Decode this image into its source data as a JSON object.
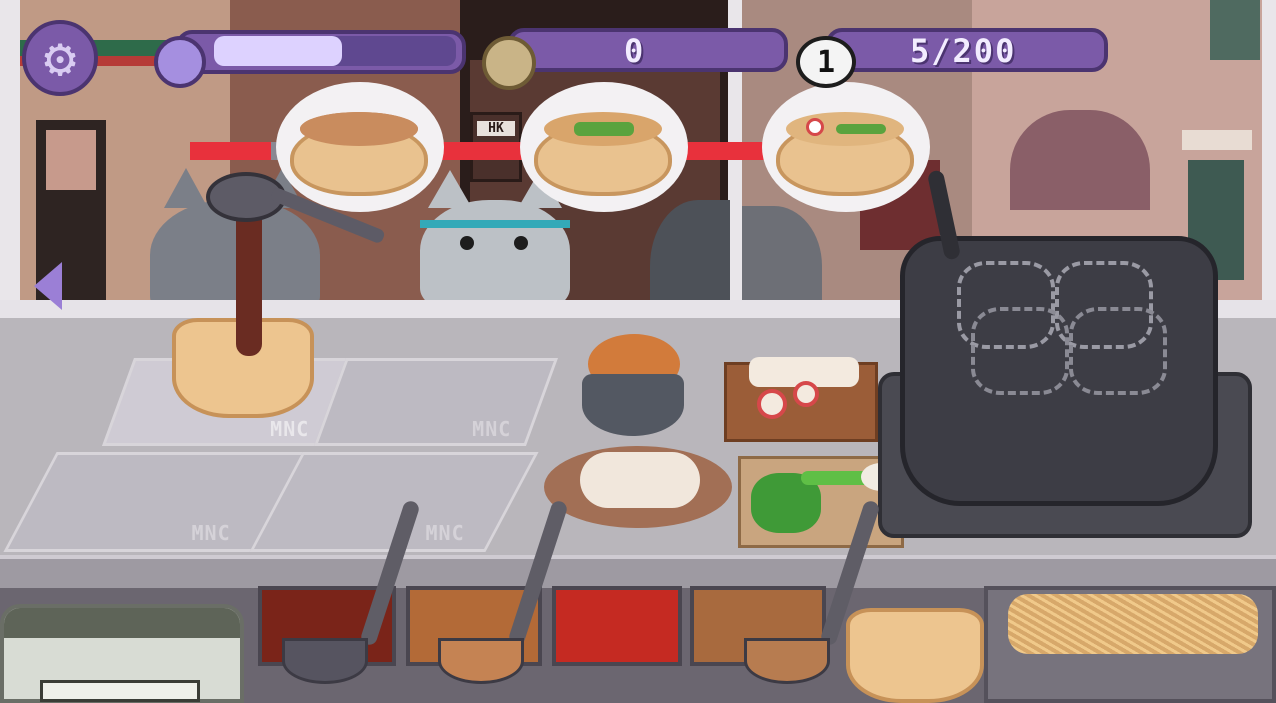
{
  "hud": {
    "settings_icon": "gear-icon",
    "mood_icon": "smile-icon",
    "mood_level": 0.53,
    "coins": "0",
    "coin_icon": "coin-icon",
    "bowls_icon_text": "1",
    "bowls_served": "5/200"
  },
  "orders": [
    {
      "timer_remaining": 0.58
    },
    {
      "timer_remaining": 0.88
    },
    {
      "timer_remaining": 0.98
    }
  ],
  "sign": {
    "text": "HK"
  },
  "stations": [
    {
      "label": "MNC"
    },
    {
      "label": "MNC"
    },
    {
      "label": "MNC"
    },
    {
      "label": "MNC"
    }
  ],
  "nav": {
    "back_icon": "triangle-left-icon"
  },
  "colors": {
    "hud_purple": "#7b5aa8",
    "timer_red": "#e8313c",
    "timer_gray": "#8a8892"
  }
}
